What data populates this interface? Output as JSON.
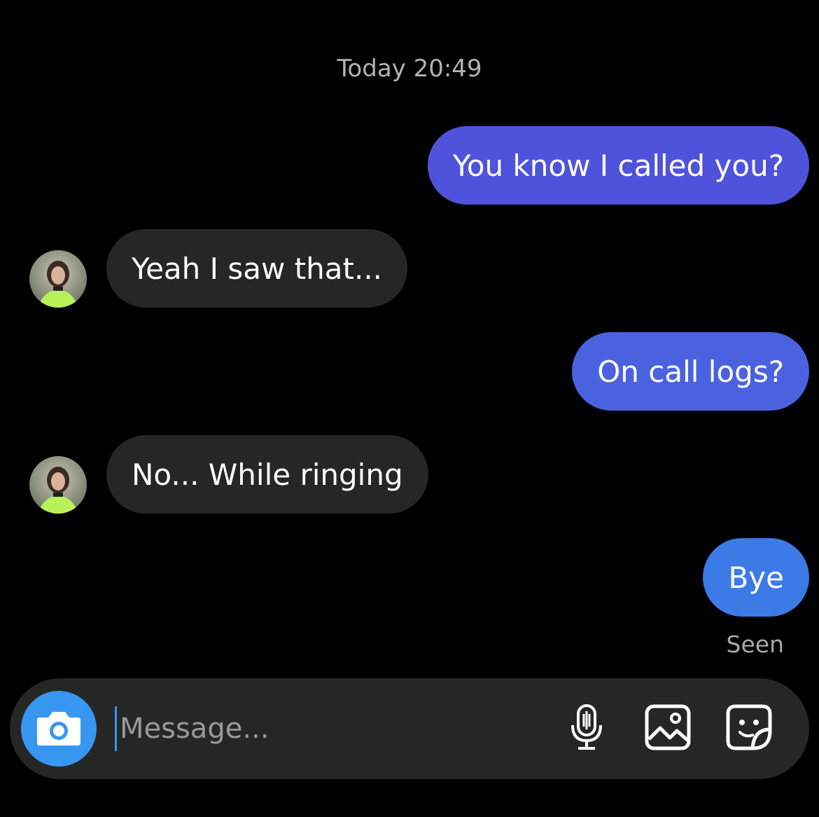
{
  "colors": {
    "background": "#000000",
    "outgoing_bubble": "#4f53db",
    "incoming_bubble": "#262626",
    "accent": "#3797f0",
    "muted_text": "#b3b3b3"
  },
  "header": {
    "timestamp": "Today 20:49"
  },
  "messages": [
    {
      "direction": "outgoing",
      "text": "You know I called you?"
    },
    {
      "direction": "incoming",
      "text": "Yeah I saw that..."
    },
    {
      "direction": "outgoing",
      "text": "On call logs?"
    },
    {
      "direction": "incoming",
      "text": "No... While ringing"
    },
    {
      "direction": "outgoing",
      "text": "Bye"
    }
  ],
  "status": {
    "seen": "Seen"
  },
  "composer": {
    "placeholder": "Message...",
    "value": "",
    "icons": [
      "camera-icon",
      "microphone-icon",
      "gallery-icon",
      "sticker-icon"
    ]
  }
}
